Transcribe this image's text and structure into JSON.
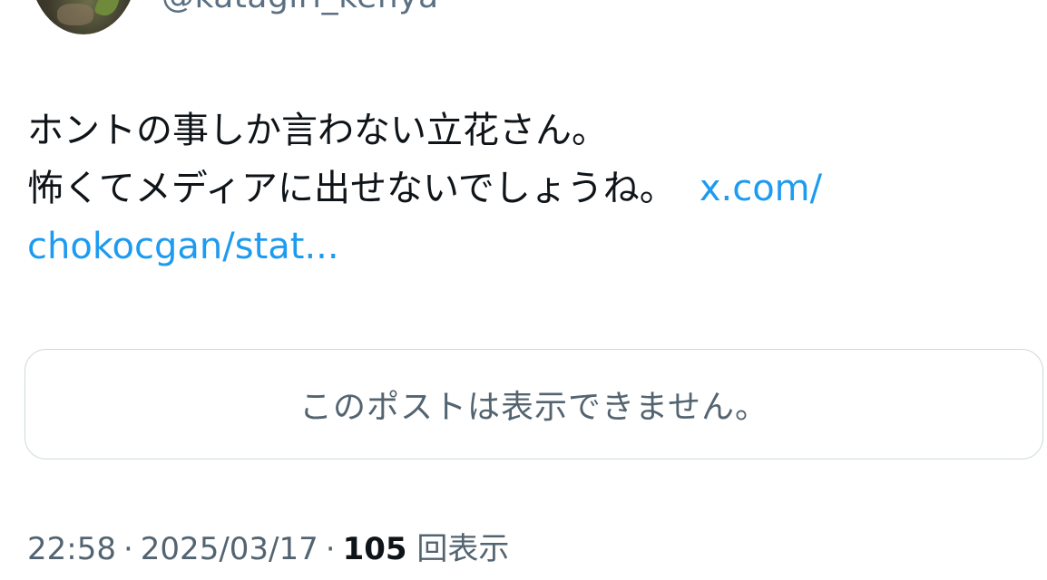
{
  "author": {
    "handle": "@katagiri_kenya"
  },
  "post": {
    "line1": "ホントの事しか言わない立花さん。",
    "line2": "怖くてメディアに出せないでしょうね。",
    "link_part1": "x.com/",
    "link_part2": "chokocgan/stat..."
  },
  "embed": {
    "unavailable_text": "このポストは表示できません。"
  },
  "meta": {
    "time": "22:58",
    "separator": "·",
    "date": "2025/03/17",
    "views_count": "105",
    "views_label": "回表示"
  },
  "colors": {
    "link": "#1d9bf0",
    "secondary_text": "#536471",
    "primary_text": "#0f1419",
    "border": "#cfd9de"
  }
}
